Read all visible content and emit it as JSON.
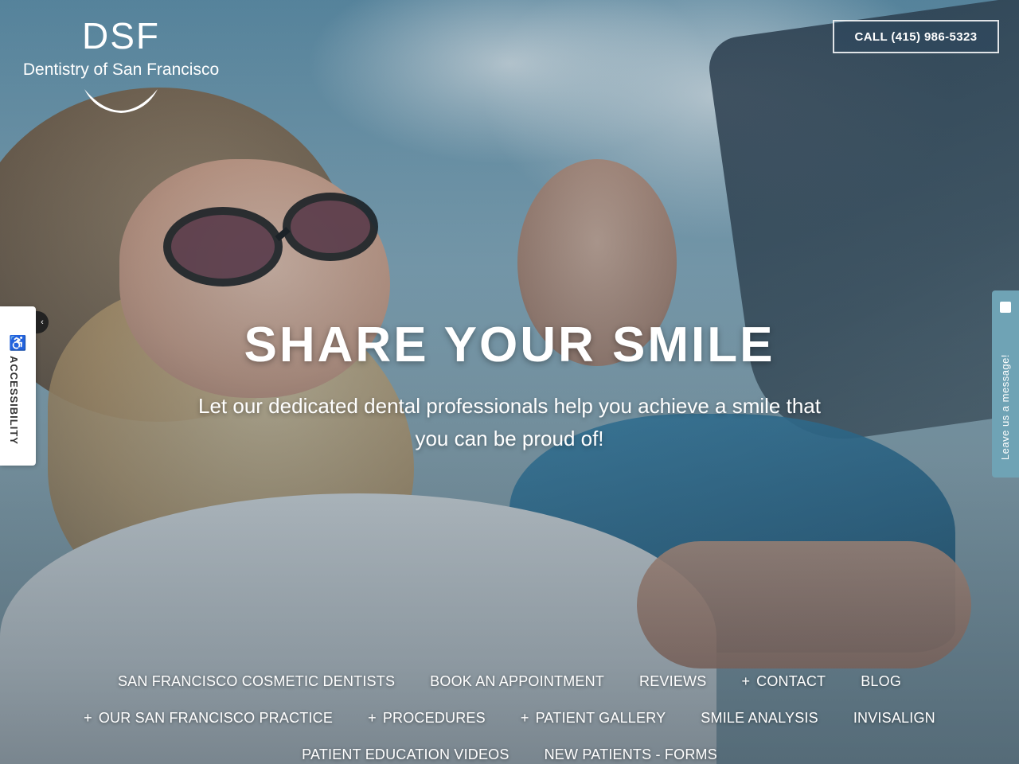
{
  "logo": {
    "mark": "DSF",
    "name": "Dentistry of San Francisco"
  },
  "header": {
    "call_label": "CALL (415) 986-5323"
  },
  "hero": {
    "headline": "SHARE YOUR SMILE",
    "subline": "Let our dedicated dental professionals help you achieve a smile that you can be proud of!"
  },
  "accessibility": {
    "label": "ACCESSIBILITY",
    "icon": "wheelchair-icon",
    "toggle_icon": "chevron-left-icon"
  },
  "message_tab": {
    "label": "Leave us a message!",
    "icon": "message-icon"
  },
  "nav": {
    "row1": [
      {
        "label": "SAN FRANCISCO COSMETIC DENTISTS",
        "plus": ""
      },
      {
        "label": "BOOK AN APPOINTMENT",
        "plus": ""
      },
      {
        "label": "REVIEWS",
        "plus": ""
      },
      {
        "label": "CONTACT",
        "plus": "+"
      },
      {
        "label": "BLOG",
        "plus": ""
      }
    ],
    "row2": [
      {
        "label": "OUR SAN FRANCISCO PRACTICE",
        "plus": "+"
      },
      {
        "label": "PROCEDURES",
        "plus": "+"
      },
      {
        "label": "PATIENT GALLERY",
        "plus": "+"
      },
      {
        "label": "SMILE ANALYSIS",
        "plus": ""
      },
      {
        "label": "INVISALIGN",
        "plus": ""
      }
    ],
    "row3": [
      {
        "label": "PATIENT EDUCATION VIDEOS",
        "plus": ""
      },
      {
        "label": "NEW PATIENTS - FORMS",
        "plus": ""
      }
    ]
  }
}
